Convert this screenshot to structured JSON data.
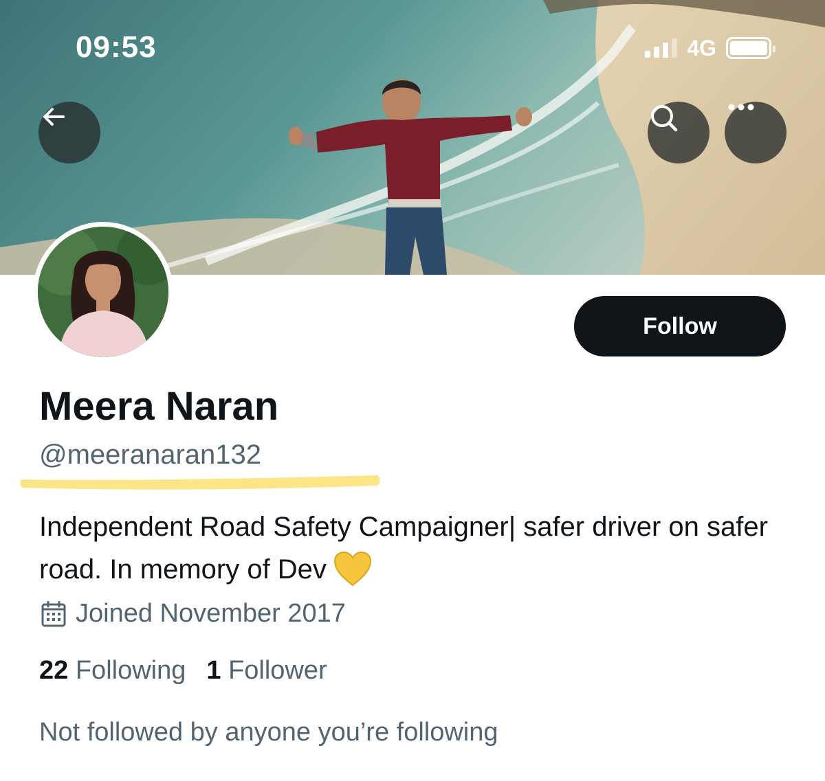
{
  "status_bar": {
    "time": "09:53",
    "network": "4G",
    "signal_icon": "signal-bars-icon",
    "battery_icon": "battery-icon"
  },
  "header": {
    "back_icon": "arrow-left-icon",
    "search_icon": "search-icon",
    "more_icon": "more-horizontal-icon"
  },
  "profile": {
    "display_name": "Meera Naran",
    "handle": "@meeranaran132",
    "bio": "Independent Road Safety Campaigner| safer driver on safer road. In memory of Dev",
    "bio_emoji": "yellow-heart-icon",
    "joined": "Joined November 2017",
    "joined_icon": "calendar-icon",
    "following_count": "22",
    "following_label": "Following",
    "followers_count": "1",
    "followers_label": "Follower",
    "mutual_note": "Not followed by anyone you’re following"
  },
  "actions": {
    "follow_label": "Follow"
  },
  "colors": {
    "primary_text": "#0f1419",
    "secondary_text": "#536471",
    "button_bg": "#0f1419",
    "highlight": "#fbe27a"
  }
}
